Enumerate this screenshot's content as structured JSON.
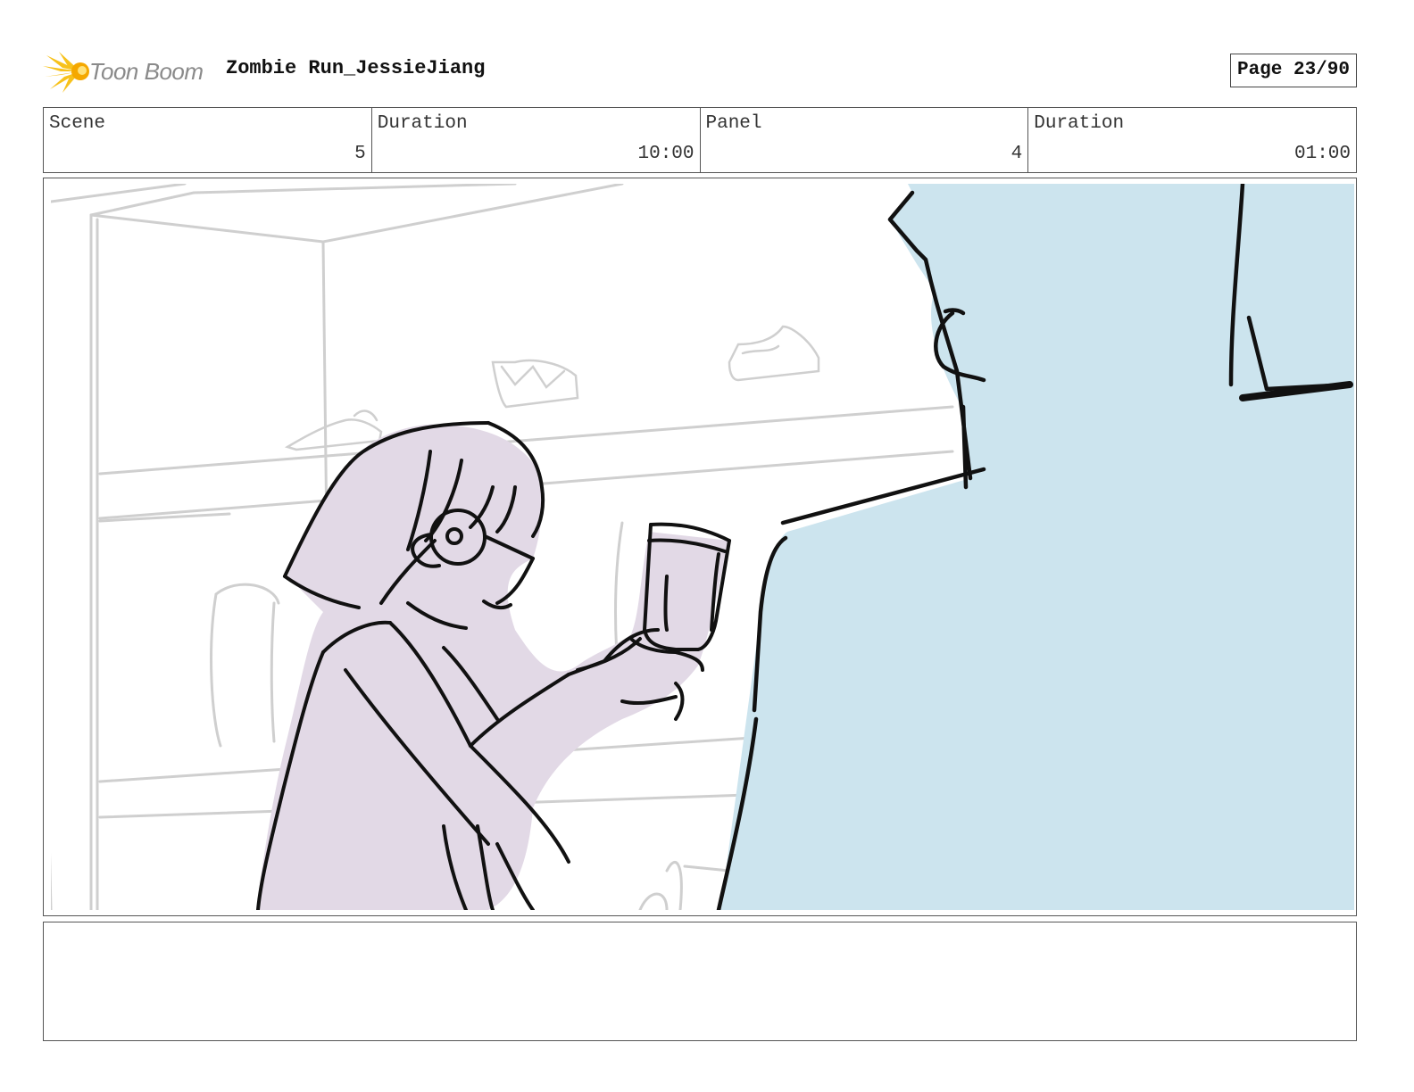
{
  "header": {
    "logo_text": "Toon Boom",
    "project_title": "Zombie Run_JessieJiang",
    "page_label": "Page 23/90"
  },
  "info": {
    "scene_label": "Scene",
    "scene_value": "5",
    "scene_duration_label": "Duration",
    "scene_duration_value": "10:00",
    "panel_label": "Panel",
    "panel_value": "4",
    "panel_duration_label": "Duration",
    "panel_duration_value": "01:00"
  },
  "panel": {
    "figure_fill_color": "#e2d9e6",
    "silhouette_fill_color": "#cce4ee",
    "background_line_color": "#cfcfcf",
    "ink_color": "#111111"
  },
  "notes": {
    "text": ""
  }
}
